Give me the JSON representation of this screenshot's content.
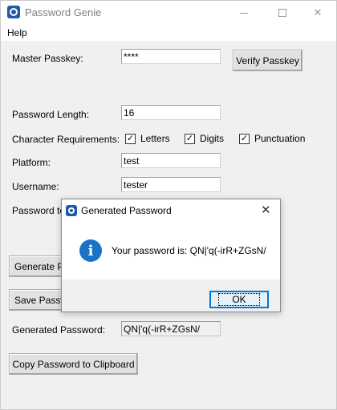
{
  "window": {
    "title": "Password Genie",
    "controls": {
      "minimize": "minimize",
      "maximize": "maximize",
      "close": "✕"
    }
  },
  "menu": {
    "help": "Help"
  },
  "form": {
    "master_passkey_label": "Master Passkey:",
    "master_passkey_value": "****",
    "verify_button": "Verify Passkey",
    "length_label": "Password Length:",
    "length_value": "16",
    "char_req_label": "Character Requirements:",
    "checkboxes": [
      {
        "label": "Letters",
        "checked": true
      },
      {
        "label": "Digits",
        "checked": true
      },
      {
        "label": "Punctuation",
        "checked": true
      }
    ],
    "platform_label": "Platform:",
    "platform_value": "test",
    "username_label": "Username:",
    "username_value": "tester",
    "password_to_label_partial": "Password to",
    "generate_button_partial": "Generate Pa",
    "save_button_partial": "Save Passw",
    "generated_label": "Generated Password:",
    "generated_value": "QN|'q(-irR+ZGsN/",
    "copy_button": "Copy Password to Clipboard"
  },
  "dialog": {
    "title": "Generated Password",
    "close": "✕",
    "message": "Your password is: QN|'q(-irR+ZGsN/",
    "ok_button": "OK",
    "icon": "info-icon"
  },
  "check_mark": "✓"
}
